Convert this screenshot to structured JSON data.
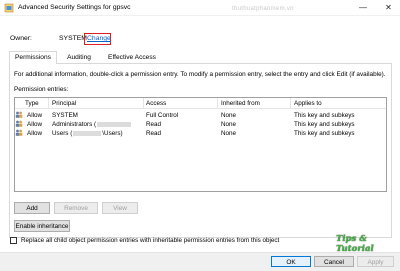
{
  "window": {
    "title": "Advanced Security Settings for gpsvc",
    "minimize_glyph": "—",
    "close_glyph": "✕",
    "watermark": "thuthuatphanmem.vn"
  },
  "owner": {
    "label": "Owner:",
    "value": "SYSTEM",
    "change_link": "Change"
  },
  "tabs": [
    {
      "label": "Permissions",
      "active": true
    },
    {
      "label": "Auditing",
      "active": false
    },
    {
      "label": "Effective Access",
      "active": false
    }
  ],
  "permissions": {
    "info_text": "For additional information, double-click a permission entry. To modify a permission entry, select the entry and click Edit (if available).",
    "entries_label": "Permission entries:",
    "columns": [
      "Type",
      "Principal",
      "Access",
      "Inherited from",
      "Applies to"
    ],
    "rows": [
      {
        "type": "Allow",
        "principal": "SYSTEM",
        "principal_suffix": "",
        "access": "Full Control",
        "inherited_from": "None",
        "applies_to": "This key and subkeys"
      },
      {
        "type": "Allow",
        "principal": "Administrators (",
        "principal_suffix": "",
        "access": "Read",
        "inherited_from": "None",
        "applies_to": "This key and subkeys"
      },
      {
        "type": "Allow",
        "principal": "Users (",
        "principal_suffix": "\\Users)",
        "access": "Read",
        "inherited_from": "None",
        "applies_to": "This key and subkeys"
      }
    ]
  },
  "buttons": {
    "add": "Add",
    "remove": "Remove",
    "view": "View",
    "enable_inheritance": "Enable inheritance",
    "ok": "OK",
    "cancel": "Cancel",
    "apply": "Apply"
  },
  "replace_child": {
    "checked": false,
    "label": "Replace all child object permission entries with inheritable permission entries from this object"
  },
  "branding": "Tips & Tutorial",
  "colors": {
    "link": "#0a66c8",
    "highlight_box": "#e02020",
    "brand_green": "#3fb53f"
  }
}
